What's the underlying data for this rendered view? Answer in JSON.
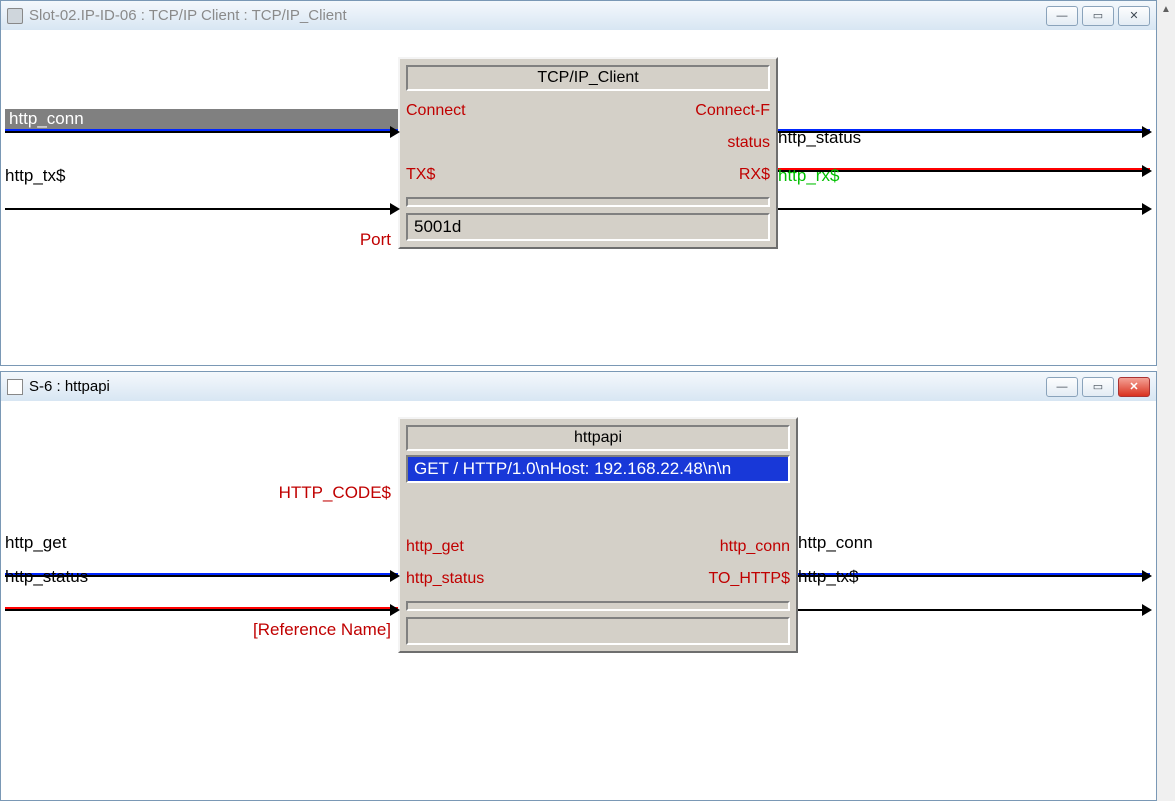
{
  "win1": {
    "title": "Slot-02.IP-ID-06 : TCP/IP Client : TCP/IP_Client",
    "block_title": "TCP/IP_Client",
    "ports": {
      "connect": "Connect",
      "connect_f": "Connect-F",
      "status": "status",
      "tx": "TX$",
      "rx": "RX$"
    },
    "port_label": "Port",
    "port_value": "5001d",
    "inputs": {
      "http_conn": "http_conn",
      "http_tx": "http_tx$"
    },
    "outputs": {
      "http_status": "http_status",
      "http_rx": "http_rx$"
    }
  },
  "win2": {
    "title": "S-6 : httpapi",
    "block_title": "httpapi",
    "http_code_label": "HTTP_CODE$",
    "http_code_value": "GET / HTTP/1.0\\nHost: 192.168.22.48\\n\\n",
    "ports": {
      "http_get_in": "http_get",
      "http_status_in": "http_status",
      "http_conn_out": "http_conn",
      "to_http_out": "TO_HTTP$"
    },
    "ref_label": "[Reference Name]",
    "ref_value": "",
    "inputs": {
      "http_get": "http_get",
      "http_status": "http_status"
    },
    "outputs": {
      "http_conn": "http_conn",
      "http_tx": "http_tx$"
    }
  },
  "wb": {
    "min": "—",
    "max": "▭",
    "close": "✕"
  }
}
